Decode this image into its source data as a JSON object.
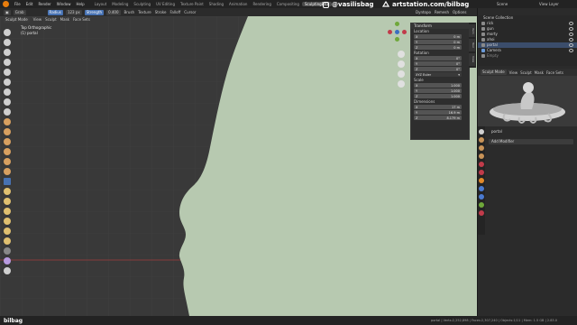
{
  "menu": [
    "File",
    "Edit",
    "Render",
    "Window",
    "Help"
  ],
  "workspaces": [
    "Layout",
    "Modeling",
    "Sculpting",
    "UV Editing",
    "Texture Paint",
    "Shading",
    "Animation",
    "Rendering",
    "Compositing",
    "SculptingBR1"
  ],
  "active_workspace": "SculptingBR1",
  "social": {
    "handle": "@vasilisbag",
    "site": "artstation.com/bilbag"
  },
  "scene_label": "Scene",
  "view_layer_label": "View Layer",
  "tool_header": {
    "brush": "Grab",
    "radius": "Radius",
    "radius_value": "123 px",
    "strength": "Strength",
    "strength_value": "0.400",
    "brush_menu": "Brush",
    "texture_menu": "Texture",
    "stroke_menu": "Stroke",
    "falloff_menu": "Falloff",
    "cursor_menu": "Cursor"
  },
  "view_header": {
    "mode": "Sculpt Mode",
    "items": [
      "View",
      "Sculpt",
      "Mask",
      "Face Sets"
    ]
  },
  "viewport": {
    "view_name": "Top Orthographic",
    "object_name": "(1) portal"
  },
  "header_right": {
    "dyntopo": "Dyntopo",
    "remesh": "Remesh",
    "options": "Options"
  },
  "npanel": {
    "title": "Transform",
    "location_label": "Location",
    "location": [
      {
        "axis": "X",
        "value": "0 m"
      },
      {
        "axis": "Y",
        "value": "0 m"
      },
      {
        "axis": "Z",
        "value": "0 m"
      }
    ],
    "rotation_label": "Rotation",
    "rotation": [
      {
        "axis": "X",
        "value": "0°"
      },
      {
        "axis": "Y",
        "value": "0°"
      },
      {
        "axis": "Z",
        "value": "0°"
      }
    ],
    "rotation_mode": "XYZ Euler",
    "scale_label": "Scale",
    "scale": [
      {
        "axis": "X",
        "value": "1.000"
      },
      {
        "axis": "Y",
        "value": "1.000"
      },
      {
        "axis": "Z",
        "value": "1.000"
      }
    ],
    "dimensions_label": "Dimensions",
    "dimensions": [
      {
        "axis": "X",
        "value": "17 m"
      },
      {
        "axis": "Y",
        "value": "16.9 m"
      },
      {
        "axis": "Z",
        "value": "8.179 m"
      }
    ],
    "tabs": [
      "Item",
      "Tool",
      "View"
    ]
  },
  "outliner": {
    "title": "Scene Collection",
    "items": [
      "rick",
      "gun",
      "morty",
      "ahoi",
      "portal",
      "Camera",
      "Empty"
    ]
  },
  "preview_header": {
    "mode": "Sculpt Mode",
    "items": [
      "View",
      "Sculpt",
      "Mask",
      "Face Sets"
    ]
  },
  "properties": {
    "object_name": "portal",
    "add_modifier": "Add Modifier"
  },
  "status": {
    "left_icon": "bilbag",
    "stats": "portal | Verts:2,252,898 | Faces:2,307,240 | Objects:1/11 | Mem: 1.5 GB | 2.83.0"
  },
  "colors": {
    "mesh_green": "#b7c9b0",
    "viewport_bg": "#393939",
    "accent_blue": "#4772b3",
    "orange": "#e87d0d"
  }
}
